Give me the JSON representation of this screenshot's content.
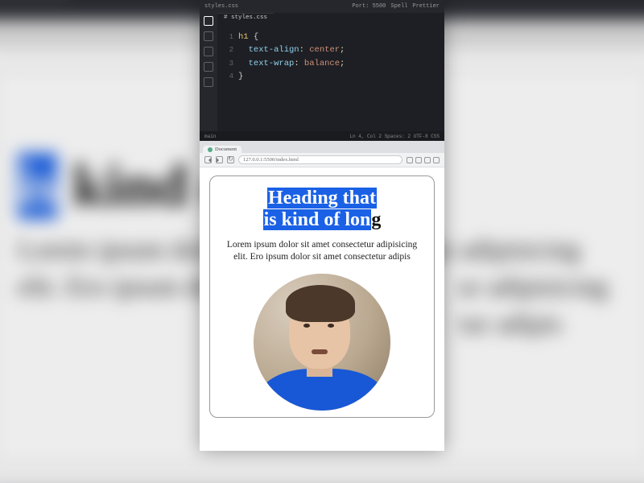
{
  "background": {
    "heading_line1_highlight_fragment": "t",
    "heading_line2_highlight": "is",
    "heading_line2_rest": " kind of long",
    "paragraph_line1": "Lorem ipsum dolor sit amet consectetur adipisicing",
    "paragraph_line2_left": "elit. Ero ipsum dolo",
    "paragraph_line2_right": "ur adipisicing",
    "paragraph_line3_right": "tur adipis"
  },
  "editor": {
    "title_left": "styles.css",
    "title_right_items": [
      "Port: 5500",
      "Spell",
      "Prettier"
    ],
    "tab": "# styles.css",
    "code": {
      "line1_ln": "1",
      "line1_selector": "h1",
      "line1_brace": " {",
      "line2_ln": "2",
      "line2_prop": "  text-align",
      "line2_colon": ": ",
      "line2_val": "center",
      "line2_semi": ";",
      "line3_ln": "3",
      "line3_prop": "  text-wrap",
      "line3_colon": ": ",
      "line3_val": "balance",
      "line3_semi": ";",
      "line4_ln": "4",
      "line4_brace": "}"
    },
    "status_left": "main",
    "status_right": "Ln 4, Col 2  Spaces: 2  UTF-8  CSS"
  },
  "browser": {
    "tab_label": "Document",
    "url": "127.0.0.1:5500/index.html",
    "page": {
      "heading_hl1": "Heading that",
      "heading_hl2": "is kind of lon",
      "heading_last": "g",
      "paragraph": "Lorem ipsum dolor sit amet consectetur adipisicing elit. Ero ipsum dolor sit amet consectetur adipis"
    }
  }
}
